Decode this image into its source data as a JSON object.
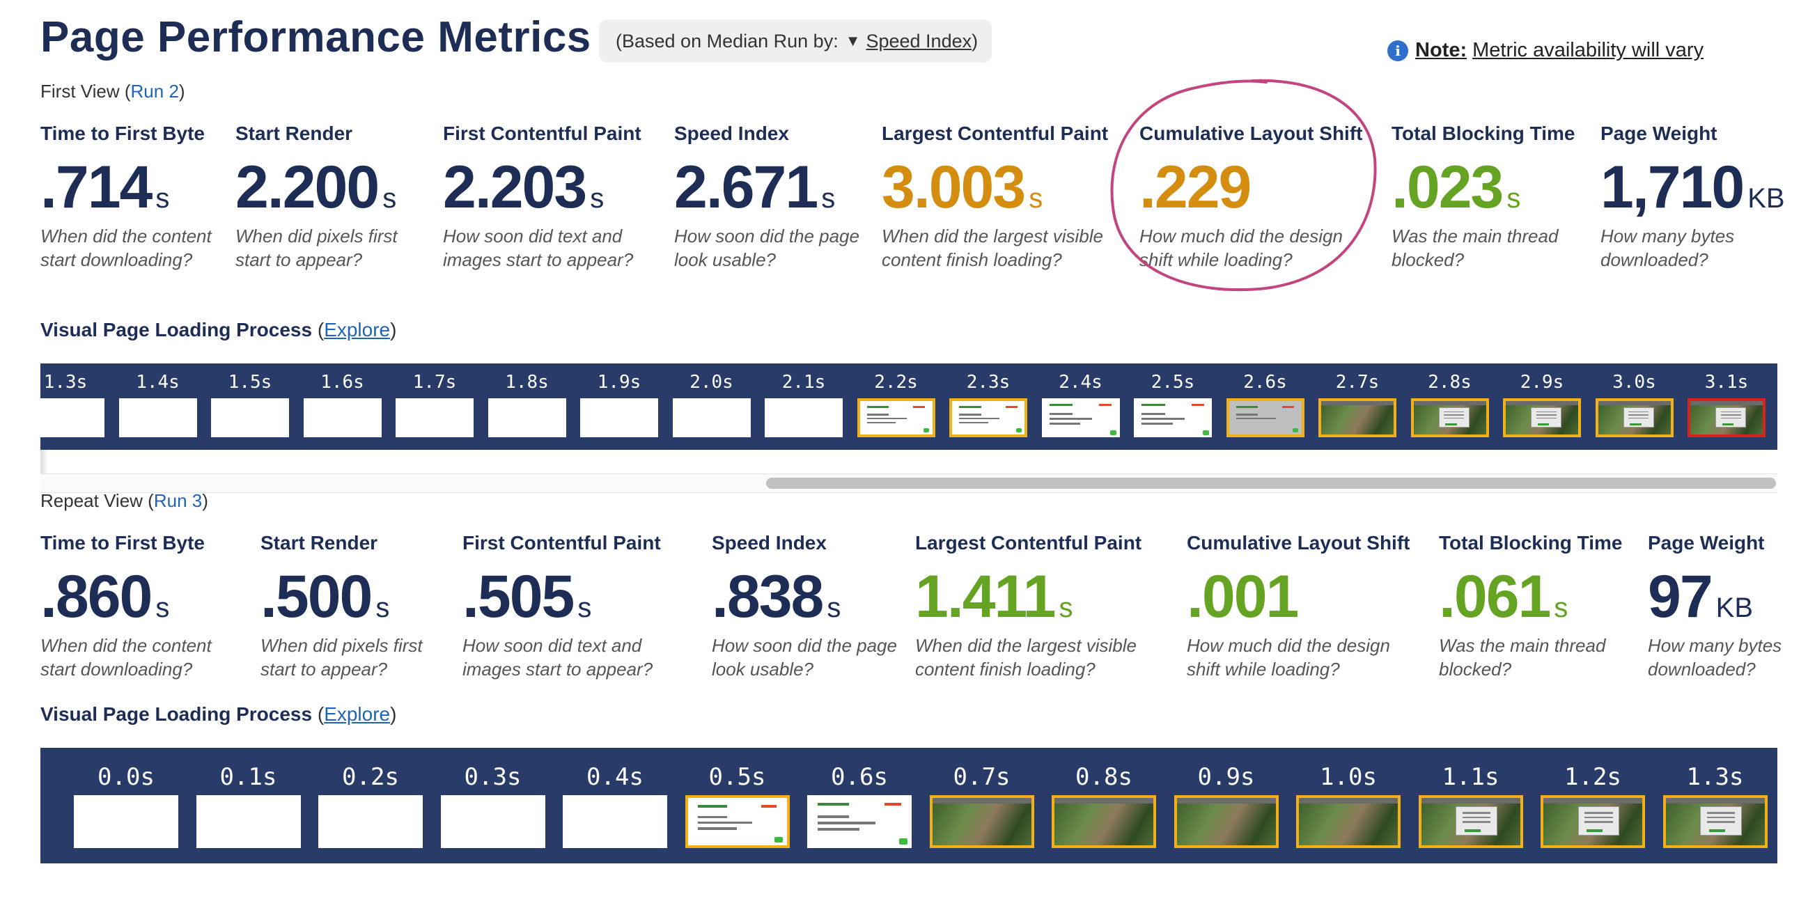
{
  "header": {
    "title": "Page Performance Metrics",
    "median_prefix": "(Based on Median Run by:",
    "median_caret": "▼",
    "median_link": "Speed Index",
    "median_suffix": ")",
    "note_icon": "info-icon",
    "note_label": "Note:",
    "note_text": "Metric availability will vary"
  },
  "colors": {
    "navy": "#1d2d56",
    "orange": "#d58d10",
    "green": "#65a322",
    "link": "#1f64b8",
    "strip": "#283b69",
    "frame_orange": "#f2b116",
    "frame_red": "#d9231b",
    "annotation": "#c2457f"
  },
  "first_view": {
    "label": "First View (",
    "run_link": "Run 2",
    "close": ")",
    "metrics": [
      {
        "label": "Time to First Byte",
        "value": ".714",
        "unit": "s",
        "color": "navy",
        "desc": "When did the content start downloading?"
      },
      {
        "label": "Start Render",
        "value": "2.200",
        "unit": "s",
        "color": "navy",
        "desc": "When did pixels first start to appear?"
      },
      {
        "label": "First Contentful Paint",
        "value": "2.203",
        "unit": "s",
        "color": "navy",
        "desc": "How soon did text and images start to appear?"
      },
      {
        "label": "Speed Index",
        "value": "2.671",
        "unit": "s",
        "color": "navy",
        "desc": "How soon did the page look usable?"
      },
      {
        "label": "Largest Contentful Paint",
        "value": "3.003",
        "unit": "s",
        "color": "orange",
        "desc": "When did the largest visible content finish loading?"
      },
      {
        "label": "Cumulative Layout Shift",
        "value": ".229",
        "unit": "",
        "color": "orange",
        "desc": "How much did the design shift while loading?"
      },
      {
        "label": "Total Blocking Time",
        "value": ".023",
        "unit": "s",
        "color": "green",
        "desc": "Was the main thread blocked?"
      },
      {
        "label": "Page Weight",
        "value": "1,710",
        "unit": "KB",
        "color": "navy",
        "desc": "How many bytes downloaded?"
      }
    ],
    "visual_title": "Visual Page Loading Process",
    "explore_open": " (",
    "explore_link": "Explore",
    "explore_close": ")",
    "frames": [
      {
        "time": "1.3s",
        "state": "blank",
        "border": "none"
      },
      {
        "time": "1.4s",
        "state": "blank",
        "border": "none"
      },
      {
        "time": "1.5s",
        "state": "blank",
        "border": "none"
      },
      {
        "time": "1.6s",
        "state": "blank",
        "border": "none"
      },
      {
        "time": "1.7s",
        "state": "blank",
        "border": "none"
      },
      {
        "time": "1.8s",
        "state": "blank",
        "border": "none"
      },
      {
        "time": "1.9s",
        "state": "blank",
        "border": "none"
      },
      {
        "time": "2.0s",
        "state": "blank",
        "border": "none"
      },
      {
        "time": "2.1s",
        "state": "blank",
        "border": "none"
      },
      {
        "time": "2.2s",
        "state": "text",
        "border": "orange"
      },
      {
        "time": "2.3s",
        "state": "text",
        "border": "orange"
      },
      {
        "time": "2.4s",
        "state": "text",
        "border": "none"
      },
      {
        "time": "2.5s",
        "state": "text",
        "border": "none"
      },
      {
        "time": "2.6s",
        "state": "grey",
        "border": "orange"
      },
      {
        "time": "2.7s",
        "state": "photo",
        "border": "orange"
      },
      {
        "time": "2.8s",
        "state": "photo-modal",
        "border": "orange"
      },
      {
        "time": "2.9s",
        "state": "photo-modal",
        "border": "orange"
      },
      {
        "time": "3.0s",
        "state": "photo-modal",
        "border": "orange"
      },
      {
        "time": "3.1s",
        "state": "photo-modal",
        "border": "red"
      }
    ]
  },
  "repeat_view": {
    "label": "Repeat View (",
    "run_link": "Run 3",
    "close": ")",
    "metrics": [
      {
        "label": "Time to First Byte",
        "value": ".860",
        "unit": "s",
        "color": "navy",
        "desc": "When did the content start downloading?"
      },
      {
        "label": "Start Render",
        "value": ".500",
        "unit": "s",
        "color": "navy",
        "desc": "When did pixels first start to appear?"
      },
      {
        "label": "First Contentful Paint",
        "value": ".505",
        "unit": "s",
        "color": "navy",
        "desc": "How soon did text and images start to appear?"
      },
      {
        "label": "Speed Index",
        "value": ".838",
        "unit": "s",
        "color": "navy",
        "desc": "How soon did the page look usable?"
      },
      {
        "label": "Largest Contentful Paint",
        "value": "1.411",
        "unit": "s",
        "color": "green",
        "desc": "When did the largest visible content finish loading?"
      },
      {
        "label": "Cumulative Layout Shift",
        "value": ".001",
        "unit": "",
        "color": "green",
        "desc": "How much did the design shift while loading?"
      },
      {
        "label": "Total Blocking Time",
        "value": ".061",
        "unit": "s",
        "color": "green",
        "desc": "Was the main thread blocked?"
      },
      {
        "label": "Page Weight",
        "value": "97",
        "unit": "KB",
        "color": "navy",
        "desc": "How many bytes downloaded?"
      }
    ],
    "visual_title": "Visual Page Loading Process",
    "explore_open": " (",
    "explore_link": "Explore",
    "explore_close": ")",
    "frames": [
      {
        "time": "0.0s",
        "state": "blank",
        "border": "none"
      },
      {
        "time": "0.1s",
        "state": "blank",
        "border": "none"
      },
      {
        "time": "0.2s",
        "state": "blank",
        "border": "none"
      },
      {
        "time": "0.3s",
        "state": "blank",
        "border": "none"
      },
      {
        "time": "0.4s",
        "state": "blank",
        "border": "none"
      },
      {
        "time": "0.5s",
        "state": "text",
        "border": "orange"
      },
      {
        "time": "0.6s",
        "state": "text",
        "border": "none"
      },
      {
        "time": "0.7s",
        "state": "photo",
        "border": "orange"
      },
      {
        "time": "0.8s",
        "state": "photo",
        "border": "orange"
      },
      {
        "time": "0.9s",
        "state": "photo",
        "border": "orange"
      },
      {
        "time": "1.0s",
        "state": "photo",
        "border": "orange"
      },
      {
        "time": "1.1s",
        "state": "photo-modal",
        "border": "orange"
      },
      {
        "time": "1.2s",
        "state": "photo-modal",
        "border": "orange"
      },
      {
        "time": "1.3s",
        "state": "photo-modal",
        "border": "orange"
      }
    ]
  }
}
